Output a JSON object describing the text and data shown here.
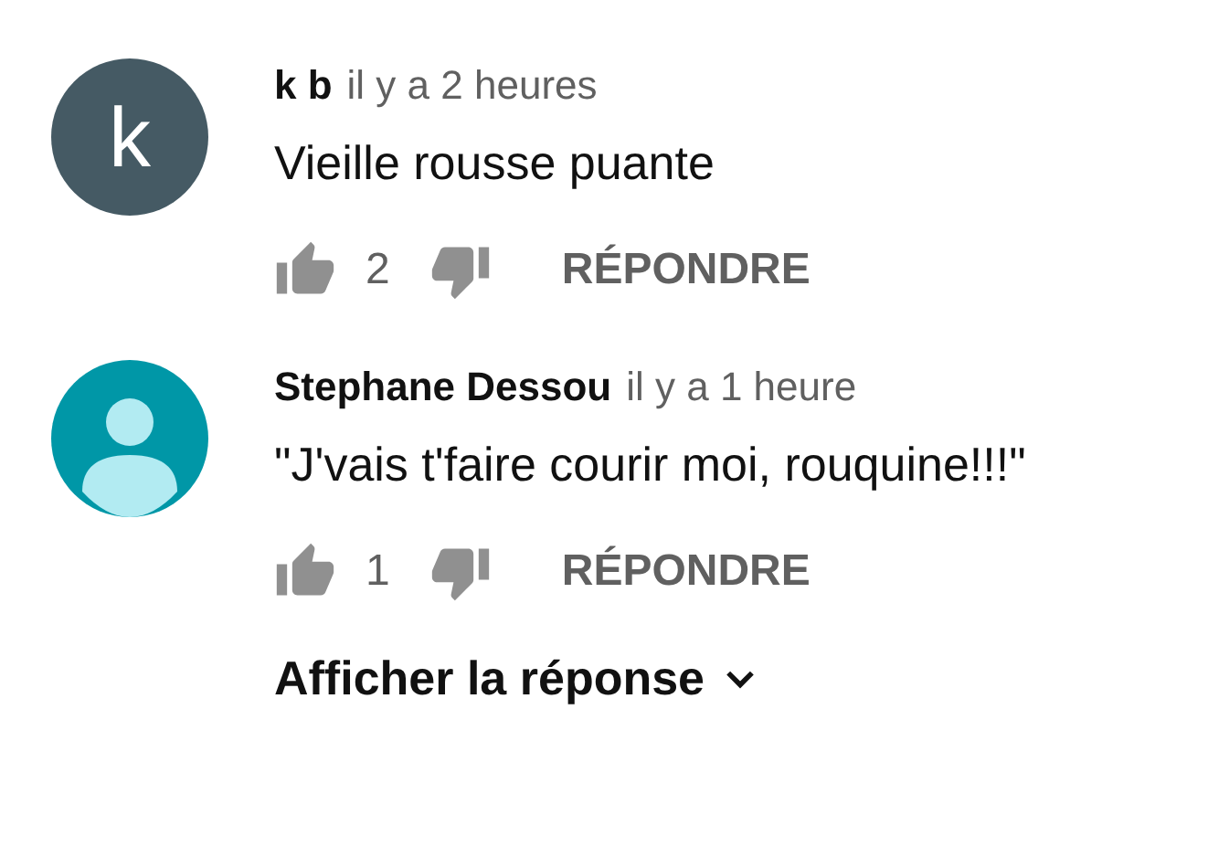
{
  "comments": [
    {
      "avatar": {
        "kind": "letter",
        "letter": "k",
        "color": "#455a64"
      },
      "author": "k b",
      "time": "il y a 2 heures",
      "text": "Vieille rousse puante",
      "likes": "2",
      "reply_label": "RÉPONDRE"
    },
    {
      "avatar": {
        "kind": "silhouette",
        "color": "#0097a7"
      },
      "author": "Stephane Dessou",
      "time": "il y a 1 heure",
      "text": "\"J'vais t'faire courir moi, rouquine!!!\"",
      "likes": "1",
      "reply_label": "RÉPONDRE",
      "show_replies": "Afficher la réponse"
    }
  ]
}
